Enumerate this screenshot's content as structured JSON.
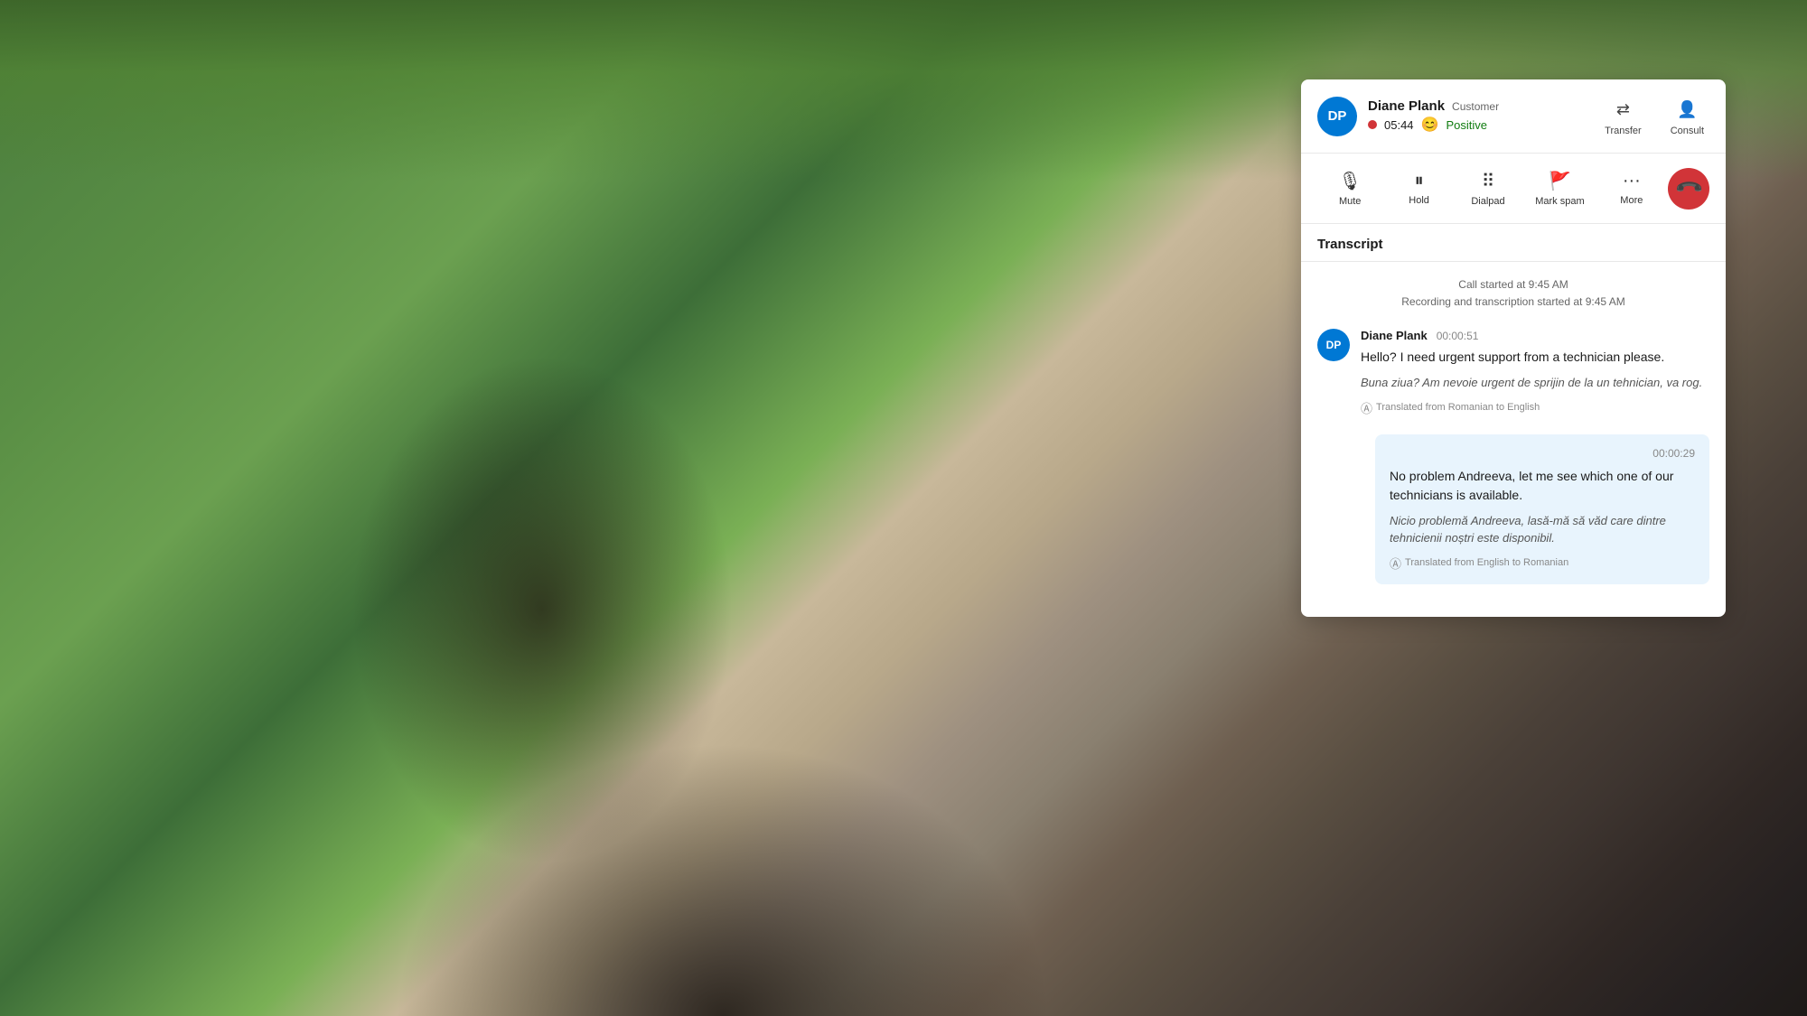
{
  "background": {
    "description": "Man sitting outdoors on bench looking at phone, green foliage background"
  },
  "panel": {
    "header": {
      "avatar_initials": "DP",
      "name": "Diane Plank",
      "role": "Customer",
      "timer": "05:44",
      "sentiment_label": "Positive",
      "transfer_label": "Transfer",
      "consult_label": "Consult"
    },
    "toolbar": {
      "mute_label": "Mute",
      "hold_label": "Hold",
      "dialpad_label": "Dialpad",
      "mark_spam_label": "Mark spam",
      "more_label": "More",
      "end_call_tooltip": "End call"
    },
    "transcript": {
      "section_title": "Transcript",
      "call_started": "Call started at 9:45 AM",
      "recording_started": "Recording and transcription started at 9:45 AM",
      "messages": [
        {
          "type": "customer",
          "avatar": "DP",
          "name": "Diane Plank",
          "time": "00:00:51",
          "text": "Hello? I need urgent support from a technician please.",
          "translated_text": "Buna ziua? Am nevoie urgent de sprijin de la un tehnician, va rog.",
          "translation_note": "Translated from Romanian to English"
        },
        {
          "type": "agent",
          "time": "00:00:29",
          "text": "No problem Andreeva, let me see which one of our technicians is available.",
          "translated_text": "Nicio problemă Andreeva, lasă-mă să văd care dintre tehnicienii noștri este disponibil.",
          "translation_note": "Translated from English to Romanian"
        }
      ]
    }
  }
}
